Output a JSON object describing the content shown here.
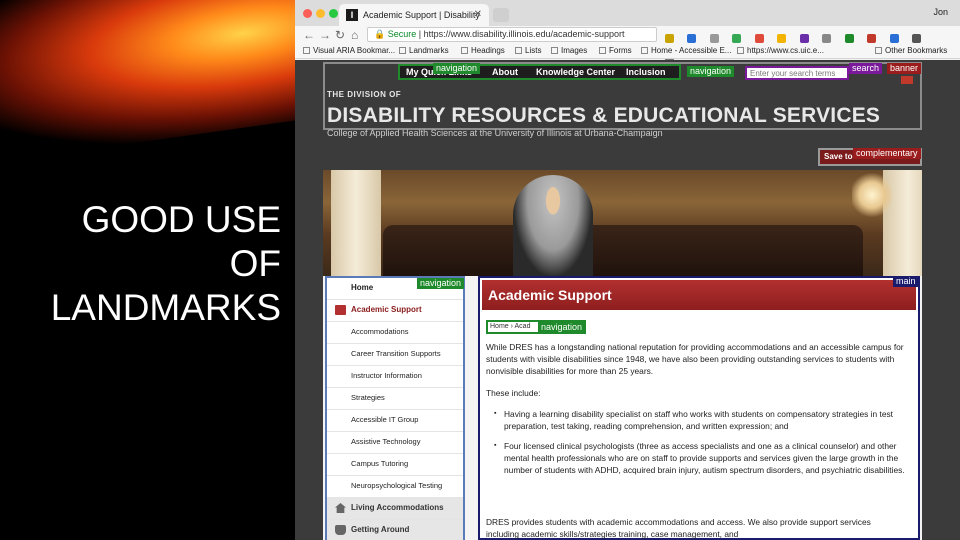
{
  "slide": {
    "title_lines": [
      "GOOD USE",
      "OF",
      "LANDMARKS"
    ]
  },
  "browser": {
    "tab_title": "Academic Support | Disability",
    "tab_favicon": "I",
    "profile": "Jon",
    "url_secure": "Secure",
    "url": "https://www.disability.illinois.edu/academic-support",
    "bookmarks": [
      "Visual ARIA Bookmar...",
      "Landmarks",
      "Headings",
      "Lists",
      "Images",
      "Forms",
      "Home - Accessible E...",
      "https://www.cs.uic.e...",
      "Other Bookmarks"
    ]
  },
  "landmarks": {
    "navigation": "navigation",
    "search": "search",
    "banner": "banner",
    "complementary": "complementary",
    "main": "main"
  },
  "site": {
    "nav_items": [
      "My Quick Links",
      "About",
      "Knowledge Center",
      "Inclusion"
    ],
    "search_placeholder": "Enter your search terms",
    "division": "THE DIVISION OF",
    "name": "DISABILITY RESOURCES & EDUCATIONAL SERVICES",
    "college": "College of Applied Health Sciences at the University of Illinois at Urbana-Champaign",
    "save_to": "Save to"
  },
  "sidebar": {
    "items": [
      {
        "label": "Home",
        "type": "top"
      },
      {
        "label": "Academic Support",
        "type": "active"
      },
      {
        "label": "Accommodations",
        "type": "sub"
      },
      {
        "label": "Career Transition Supports",
        "type": "sub"
      },
      {
        "label": "Instructor Information",
        "type": "sub"
      },
      {
        "label": "Strategies",
        "type": "sub"
      },
      {
        "label": "Accessible IT Group",
        "type": "sub"
      },
      {
        "label": "Assistive Technology",
        "type": "sub"
      },
      {
        "label": "Campus Tutoring",
        "type": "sub"
      },
      {
        "label": "Neuropsychological Testing",
        "type": "sub"
      },
      {
        "label": "Living Accommodations",
        "type": "gray"
      },
      {
        "label": "Getting Around",
        "type": "gray"
      }
    ]
  },
  "main": {
    "title": "Academic Support",
    "breadcrumb": "Home › Acad",
    "intro": "While DRES has a longstanding national reputation for providing accommodations and an accessible campus for students with visible disabilities since 1948, we have also been providing outstanding services to students with nonvisible disabilities for more than 25 years.",
    "includes_label": "These include:",
    "bullets": [
      "Having a learning disability specialist on staff who works with students on compensatory strategies in test preparation, test taking, reading comprehension, and written expression; and",
      "Four licensed clinical psychologists (three as access specialists and one as a clinical counselor) and other mental health professionals who are on staff to provide supports and services given the large growth in the number of students with ADHD, acquired brain injury, autism spectrum disorders, and psychiatric disabilities."
    ],
    "closing": "DRES provides students with academic accommodations and access. We also provide support services including academic skills/strategies training, case management, and"
  }
}
